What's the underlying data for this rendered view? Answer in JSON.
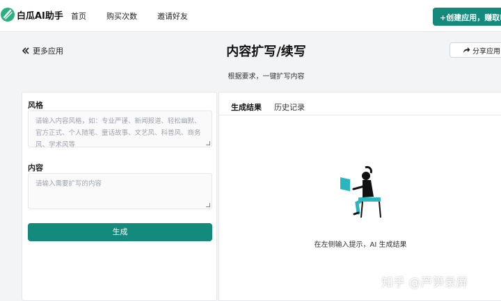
{
  "brand": {
    "name": "白瓜AI助手",
    "accent": "#138a7c"
  },
  "nav": {
    "items": [
      {
        "label": "首页"
      },
      {
        "label": "购买次数"
      },
      {
        "label": "邀请好友"
      }
    ],
    "create_button": "+创建应用，赚取收"
  },
  "page": {
    "back_label": "更多应用",
    "title": "内容扩写/续写",
    "subtitle": "根据要求，一键扩写内容",
    "share_label": "分享应用"
  },
  "form": {
    "style_label": "风格",
    "style_placeholder": "请输入内容风格，如：专业严谨、新闻报道、轻松幽默、官方正式、个人随笔、童话故事、文艺风、科普风、商务风、学术风等",
    "content_label": "内容",
    "content_placeholder": "请输入需要扩写的内容",
    "submit_label": "生成"
  },
  "results": {
    "tabs": [
      {
        "label": "生成结果",
        "active": true
      },
      {
        "label": "历史记录",
        "active": false
      }
    ],
    "empty_text": "在左侧输入提示，AI 生成结果",
    "illustration_icon": "person-at-computer-illustration"
  },
  "watermark": {
    "text": "知乎 @芦笋录屏"
  }
}
